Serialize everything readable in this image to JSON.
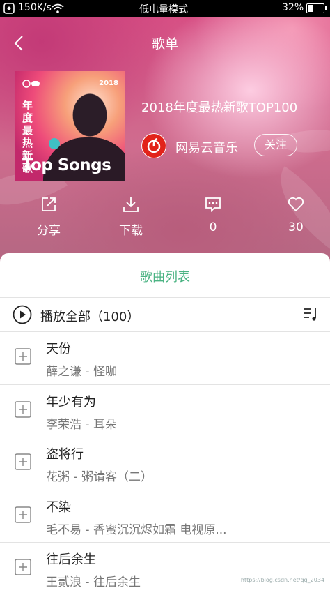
{
  "status_bar": {
    "speed": "150K/s",
    "mode": "低电量模式",
    "battery": "32%",
    "battery_level": 0.32
  },
  "header": {
    "title": "歌单"
  },
  "playlist": {
    "cover": {
      "year": "2018",
      "vertical_text": "年度最热新歌",
      "caption": "Top Songs"
    },
    "title": "2018年度最热新歌TOP100",
    "creator": "网易云音乐",
    "follow_label": "关注"
  },
  "actions": {
    "share": "分享",
    "download": "下载",
    "comments": "0",
    "likes": "30"
  },
  "tab": {
    "label": "歌曲列表"
  },
  "play_all": {
    "label": "播放全部（100）"
  },
  "songs": [
    {
      "name": "天份",
      "artist": "薛之谦 - 怪咖"
    },
    {
      "name": "年少有为",
      "artist": "李荣浩 - 耳朵"
    },
    {
      "name": "盗将行",
      "artist": "花粥 - 粥请客（二）"
    },
    {
      "name": "不染",
      "artist": "毛不易 - 香蜜沉沉烬如霜 电视原..."
    },
    {
      "name": "往后余生",
      "artist": "王贰浪 - 往后余生"
    }
  ],
  "watermark": "https://blog.csdn.net/qq_2034"
}
